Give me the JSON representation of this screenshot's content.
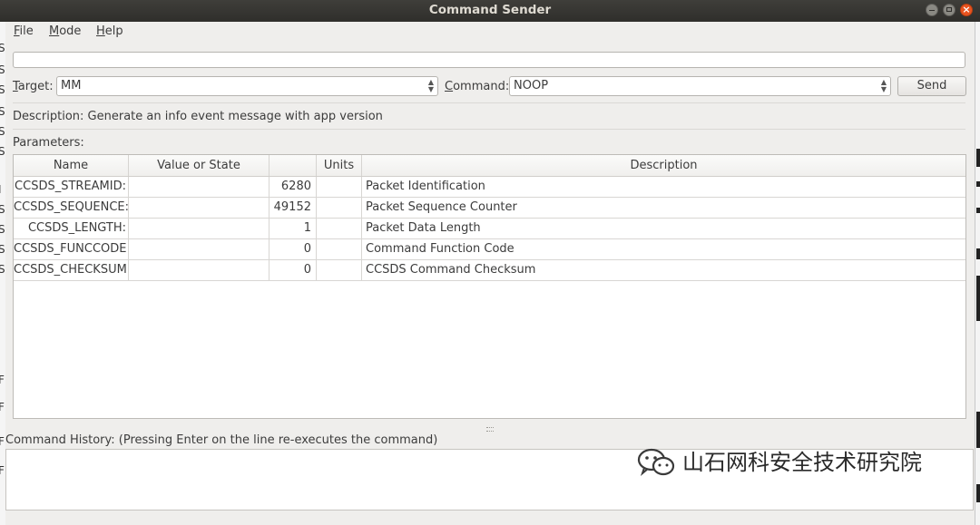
{
  "window": {
    "title": "Command Sender"
  },
  "menu": {
    "items": [
      "File",
      "Mode",
      "Help"
    ]
  },
  "command_line": {
    "value": ""
  },
  "target": {
    "label": "Target:",
    "value": "MM"
  },
  "command": {
    "label": "Command:",
    "value": "NOOP"
  },
  "send": {
    "label": "Send"
  },
  "description": {
    "text": "Description:  Generate an info event message with app version"
  },
  "parameters": {
    "label": "Parameters:",
    "columns": [
      "Name",
      "Value or State",
      "",
      "Units",
      "Description"
    ],
    "rows": [
      {
        "name": "CCSDS_STREAMID:",
        "value": "6280",
        "units": "",
        "description": "Packet Identification"
      },
      {
        "name": "CCSDS_SEQUENCE:",
        "value": "49152",
        "units": "",
        "description": "Packet Sequence Counter"
      },
      {
        "name": "CCSDS_LENGTH:",
        "value": "1",
        "units": "",
        "description": "Packet Data Length"
      },
      {
        "name": "CCSDS_FUNCCODE:",
        "value": "0",
        "units": "",
        "description": "Command Function Code"
      },
      {
        "name": "CCSDS_CHECKSUM:",
        "value": "0",
        "units": "",
        "description": "CCSDS Command Checksum"
      }
    ]
  },
  "history": {
    "label": "Command History: (Pressing Enter on the line re-executes the command)"
  },
  "watermark": {
    "text": "山石网科安全技术研究院",
    "icon": "wechat-logo-icon"
  },
  "background_glyphs": [
    "S",
    "S",
    "S",
    "S",
    "S",
    "S",
    "I",
    "S",
    "S",
    "S",
    "S",
    "F",
    "F",
    "F",
    "F"
  ],
  "colors": {
    "titlebar": "#3a3935",
    "close": "#e95420",
    "window": "#efeeec"
  }
}
